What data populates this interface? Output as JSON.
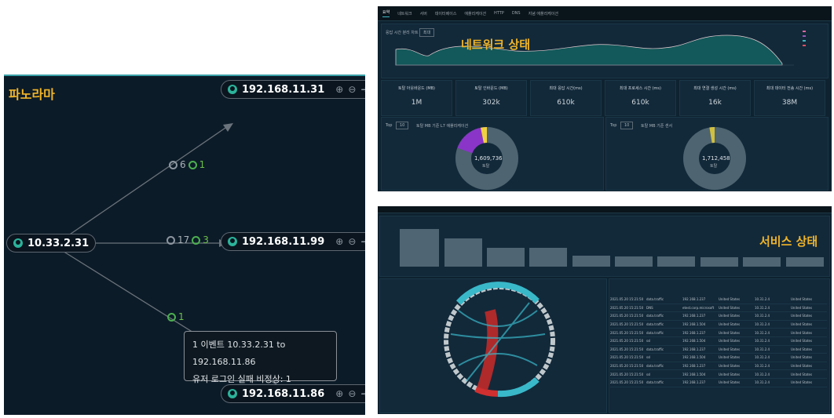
{
  "panorama": {
    "title": "파노라마",
    "source_node": {
      "ip": "10.33.2.31"
    },
    "targets": [
      {
        "ip": "192.168.11.31",
        "total": "6",
        "alerts": "1"
      },
      {
        "ip": "192.168.11.99",
        "total": "17",
        "alerts": "3"
      },
      {
        "ip": "192.168.11.86",
        "alerts": "1"
      }
    ],
    "tooltip": {
      "line1": "1 이벤트 10.33.2.31 to 192.168.11.86",
      "line2": "유저 로그인 실패 비정상: 1"
    }
  },
  "network": {
    "label": "네트워크 상태",
    "tabs": [
      "요약",
      "네트워크",
      "서버",
      "데이터베이스",
      "애플리케이션",
      "HTTP",
      "DNS",
      "지념 애플리케이션"
    ],
    "chart_title": "응답 시간 분리 차트",
    "dropdown": "최대",
    "kpis": [
      {
        "title": "토탈 아웃바운드 (MB)",
        "value": "1M"
      },
      {
        "title": "토탈 인바운드 (MB)",
        "value": "302k"
      },
      {
        "title": "최대 응답 시간(ms)",
        "value": "610k"
      },
      {
        "title": "최대 프로세스 시간 (ms)",
        "value": "610k"
      },
      {
        "title": "최대 연결 생성 시간 (ms)",
        "value": "16k"
      },
      {
        "title": "최대 데이터 전송 시간 (ms)",
        "value": "38M"
      }
    ],
    "pie_left": {
      "top": "Top",
      "n": "10",
      "title": "토탈 MB 기준 L7 애플리케이션",
      "center": "1,609,736",
      "center_sub": "토탈"
    },
    "pie_right": {
      "top": "Top",
      "n": "10",
      "title": "토탈 MB 기준 센서",
      "center": "1,712,458",
      "center_sub": "토탈"
    }
  },
  "service": {
    "label": "서비스 상태",
    "table_rows": [
      [
        "2021.05.20 15:21:50",
        "data.traffic",
        "192.168.1.237",
        "United States",
        "10.31.2.4",
        "United States"
      ],
      [
        "2021.05.20 15:21:50",
        "DNS",
        "etest.corp.microsoft",
        "United States",
        "10.31.2.4",
        "United States"
      ],
      [
        "2021.05.20 15:21:50",
        "data.traffic",
        "192.168.1.237",
        "United States",
        "10.31.2.4",
        "United States"
      ],
      [
        "2021.05.20 15:21:50",
        "data.traffic",
        "192.168.1.504",
        "United States",
        "10.31.2.4",
        "United States"
      ],
      [
        "2021.05.20 15:21:50",
        "data.traffic",
        "192.168.1.237",
        "United States",
        "10.31.2.4",
        "United States"
      ],
      [
        "2021.05.20 15:21:50",
        "ssl",
        "192.168.1.504",
        "United States",
        "10.31.2.4",
        "United States"
      ],
      [
        "2021.05.20 15:21:50",
        "data.traffic",
        "192.168.1.237",
        "United States",
        "10.31.2.4",
        "United States"
      ],
      [
        "2021.05.20 15:21:50",
        "ssl",
        "192.168.1.504",
        "United States",
        "10.31.2.4",
        "United States"
      ],
      [
        "2021.05.20 15:21:50",
        "data.traffic",
        "192.168.1.237",
        "United States",
        "10.31.2.4",
        "United States"
      ],
      [
        "2021.05.20 15:21:50",
        "ssl",
        "192.168.1.504",
        "United States",
        "10.31.2.4",
        "United States"
      ],
      [
        "2021.05.20 15:21:50",
        "data.traffic",
        "192.168.1.237",
        "United States",
        "10.31.2.4",
        "United States"
      ]
    ]
  },
  "colors": {
    "accent": "#3fb6c0",
    "label": "#f0b428",
    "panel": "#0c1b28"
  }
}
